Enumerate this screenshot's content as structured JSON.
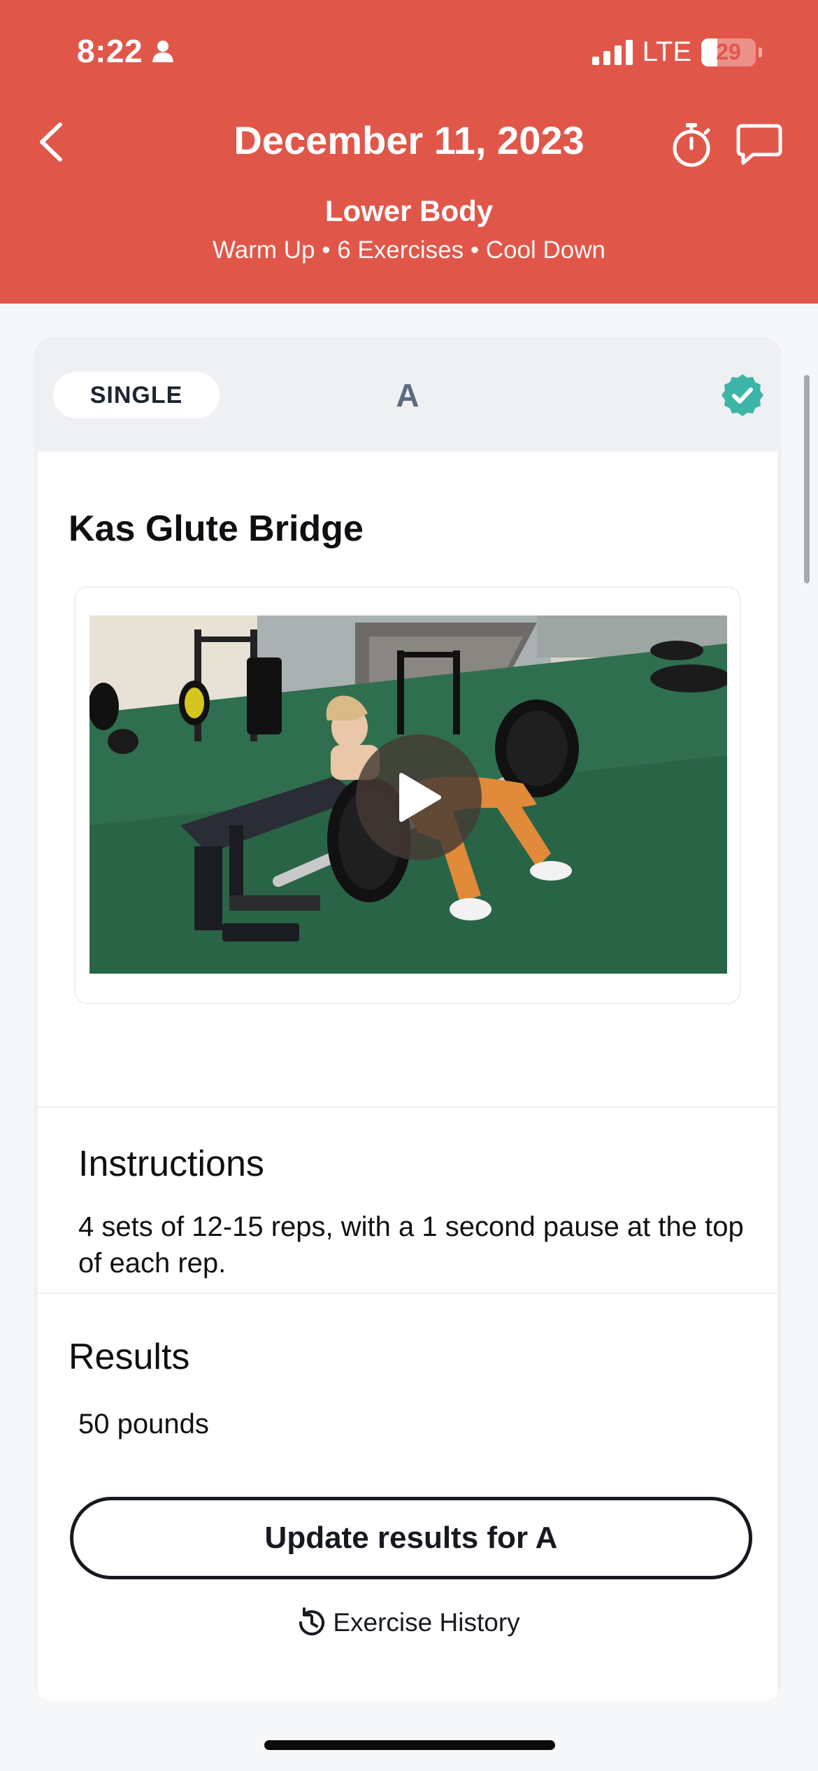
{
  "status_bar": {
    "time": "8:22",
    "network": "LTE",
    "battery": "29",
    "battery_level_percent": 29
  },
  "header": {
    "title": "December 11, 2023",
    "workout_name": "Lower Body",
    "summary": "Warm Up • 6 Exercises • Cool Down",
    "icons": [
      "back-chevron-icon",
      "stopwatch-icon",
      "chat-bubble-icon"
    ],
    "background_color": "#e0574a"
  },
  "card": {
    "type_label": "SINGLE",
    "block_letter": "A",
    "completed_icon": "verified-check-icon",
    "completed_color": "#3db5a6",
    "exercise_name": "Kas Glute Bridge",
    "video": {
      "play_icon": "play-icon"
    },
    "instructions": {
      "heading": "Instructions",
      "text": "4 sets of 12-15 reps, with a 1 second pause at the top of each rep."
    },
    "results": {
      "heading": "Results",
      "value": "50 pounds"
    },
    "update_button_label": "Update results for A",
    "history_link_label": "Exercise History"
  }
}
